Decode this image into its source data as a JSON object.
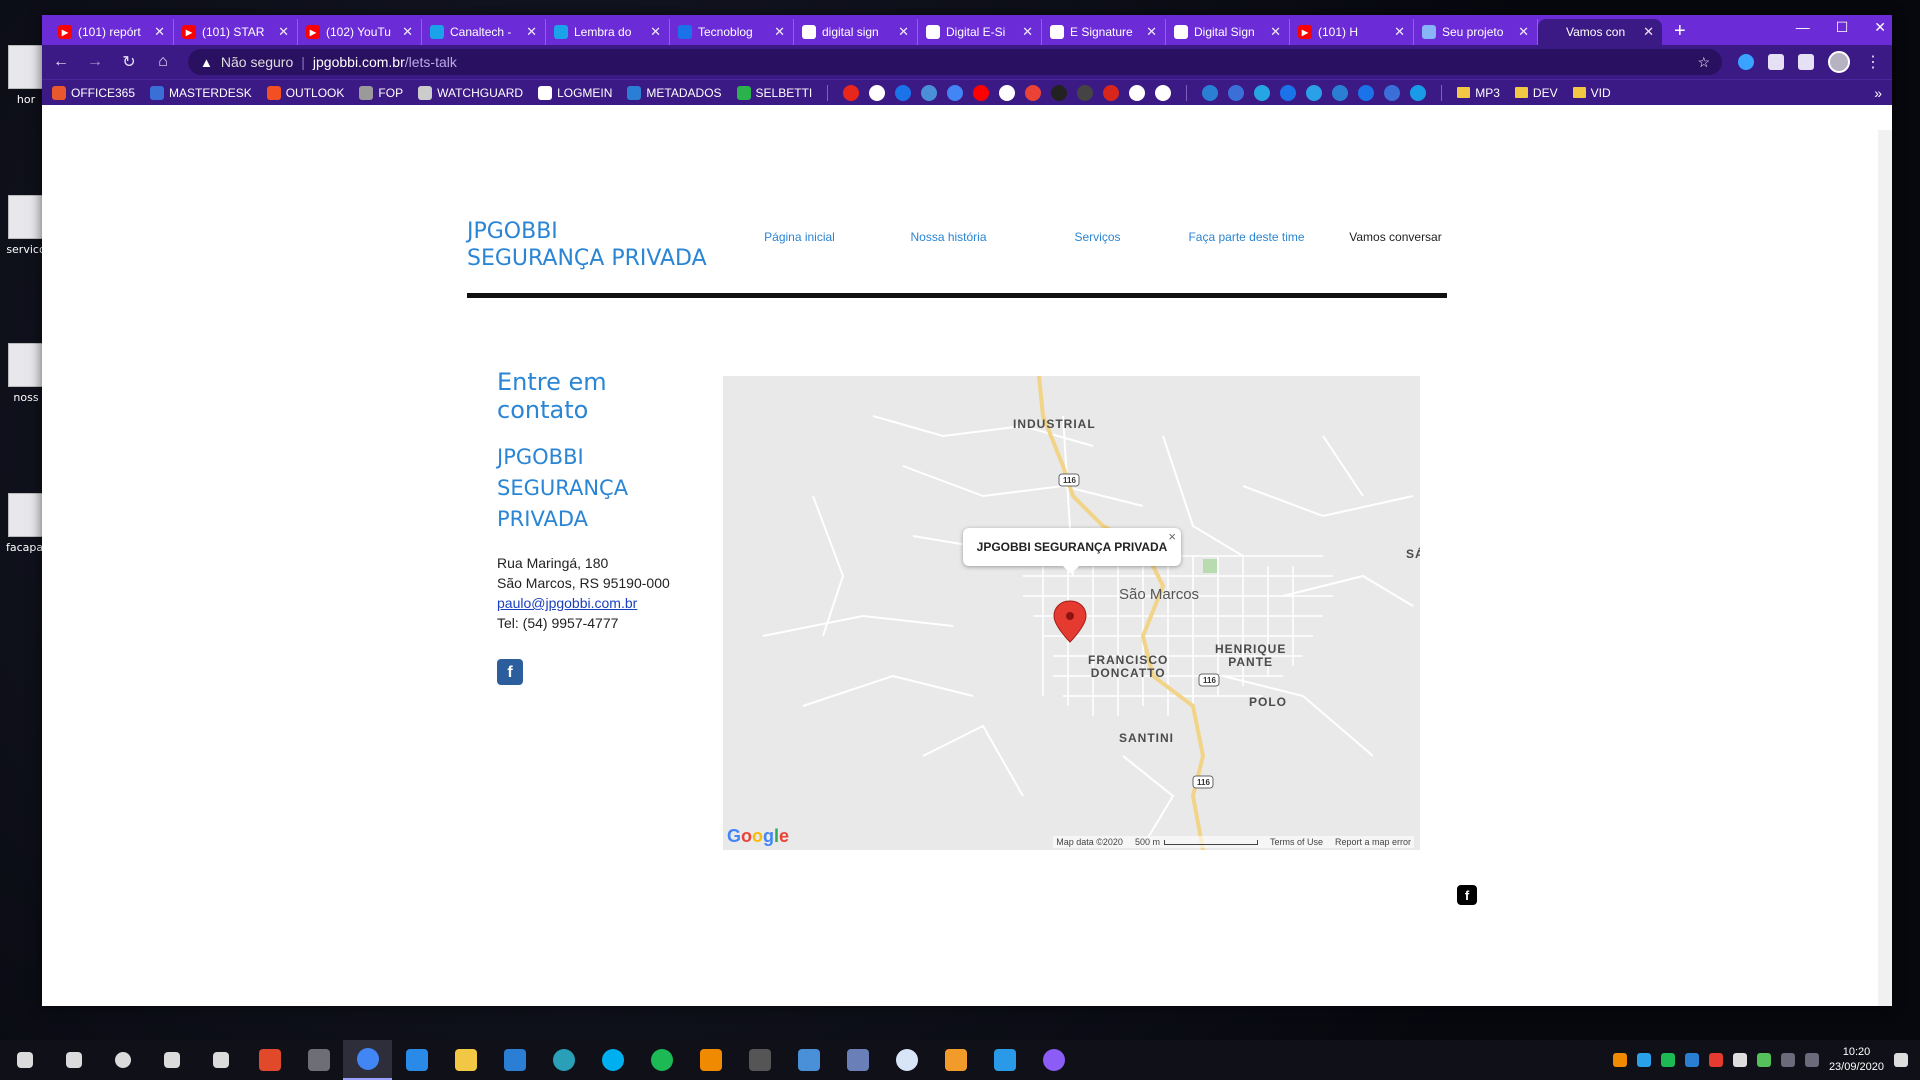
{
  "desktop": {
    "icons": [
      {
        "label": "hor"
      },
      {
        "label": "servico"
      },
      {
        "label": "noss"
      },
      {
        "label": "facapar"
      }
    ]
  },
  "browser": {
    "tabs": [
      {
        "title": "(101) repórt",
        "icon": "youtube",
        "color": "#ff0000"
      },
      {
        "title": "(101) STAR",
        "icon": "youtube",
        "color": "#ff0000"
      },
      {
        "title": "(102) YouTu",
        "icon": "youtube",
        "color": "#ff0000"
      },
      {
        "title": "Canaltech -",
        "icon": "canaltech",
        "color": "#1aa3e8"
      },
      {
        "title": "Lembra do",
        "icon": "canaltech",
        "color": "#1aa3e8"
      },
      {
        "title": "Tecnoblog",
        "icon": "tecnoblog",
        "color": "#1a73e8"
      },
      {
        "title": "digital sign",
        "icon": "google",
        "color": "#ffffff"
      },
      {
        "title": "Digital E-Si",
        "icon": "doc",
        "color": "#ffffff"
      },
      {
        "title": "E Signature",
        "icon": "github",
        "color": "#ffffff"
      },
      {
        "title": "Digital Sign",
        "icon": "github",
        "color": "#ffffff"
      },
      {
        "title": "(101) H",
        "icon": "youtube",
        "color": "#ff0000"
      },
      {
        "title": "Seu projeto",
        "icon": "loading",
        "color": "#8ab4f8"
      },
      {
        "title": "Vamos con",
        "icon": "none",
        "color": "#3c1a85"
      }
    ],
    "active_tab_index": 12,
    "new_tab_label": "+",
    "window_controls": {
      "minimize": "—",
      "maximize": "☐",
      "close": "✕"
    },
    "address": {
      "security_label": "Não seguro",
      "host": "jpgobbi.com.br",
      "path": "/lets-talk"
    },
    "bookmarks": [
      {
        "label": "OFFICE365",
        "color": "#e8572d"
      },
      {
        "label": "MASTERDESK",
        "color": "#3b6fd8"
      },
      {
        "label": "OUTLOOK",
        "color": "#f25022"
      },
      {
        "label": "FOP",
        "color": "#9a9a9a"
      },
      {
        "label": "WATCHGUARD",
        "color": "#cccccc"
      },
      {
        "label": "LOGMEIN",
        "color": "#ffffff"
      },
      {
        "label": "METADADOS",
        "color": "#2a7fd4"
      },
      {
        "label": "SELBETTI",
        "color": "#2bb24c"
      }
    ],
    "bookmark_icon_colors": [
      "#e8261c",
      "#ffffff",
      "#1a73e8",
      "#4a90d9",
      "#4285f4",
      "#ff0000",
      "#ffffff",
      "#ea4335",
      "#222222",
      "#444444",
      "#d9261c",
      "#ffffff",
      "#ffffff"
    ],
    "bookmark_icon_colors_2": [
      "#2a7fd4",
      "#3b6fd8",
      "#26a5e4",
      "#1a73e8",
      "#2aa0e8",
      "#2a7fd4",
      "#1a73e8",
      "#3b6fd8",
      "#1a9be8"
    ],
    "bookmark_folders": [
      "MP3",
      "DEV",
      "VID"
    ],
    "more_bookmarks": "»"
  },
  "site": {
    "logo_line1": "JPGOBBI",
    "logo_line2": "SEGURANÇA PRIVADA",
    "menu": [
      {
        "label": "Página inicial",
        "current": false
      },
      {
        "label": "Nossa história",
        "current": false
      },
      {
        "label": "Serviços",
        "current": false
      },
      {
        "label": "Faça parte deste time",
        "current": false
      },
      {
        "label": "Vamos conversar",
        "current": true
      }
    ],
    "contact": {
      "heading": "Entre em contato",
      "company_line1": "JPGOBBI",
      "company_line2": "SEGURANÇA",
      "company_line3": "PRIVADA",
      "street": "Rua Maringá, 180",
      "city_line": "São Marcos, RS 95190-000",
      "email": "paulo@jpgobbi.com.br",
      "phone": "Tel: (54) 9957-4777",
      "facebook_glyph": "f"
    },
    "map": {
      "popup": "JPGOBBI SEGURANÇA PRIVADA",
      "popup_close": "×",
      "city": "São Marcos",
      "labels": {
        "industrial": "INDUSTRIAL",
        "henrique_pante_1": "HENRIQUE",
        "henrique_pante_2": "PANTE",
        "francisco_doncatto_1": "FRANCISCO",
        "francisco_doncatto_2": "DONCATTO",
        "polo": "POLO",
        "santini": "SANTINI",
        "edge": "SÁ"
      },
      "road_badge": "116",
      "google_logo": "Google",
      "map_data": "Map data ©2020",
      "scale": "500 m",
      "terms": "Terms of Use",
      "report": "Report a map error"
    },
    "footer_facebook_glyph": "f"
  },
  "taskbar": {
    "apps": [
      {
        "name": "windows",
        "color": "#ffffff"
      },
      {
        "name": "search",
        "color": "#ffffff"
      },
      {
        "name": "cortana",
        "color": "#ffffff"
      },
      {
        "name": "task-view",
        "color": "#ffffff"
      },
      {
        "name": "settings",
        "color": "#ffffff"
      },
      {
        "name": "app-color",
        "color": "#e04a2a"
      },
      {
        "name": "calculator",
        "color": "#6e6e78"
      },
      {
        "name": "chrome",
        "color": "#4285f4"
      },
      {
        "name": "blue-app",
        "color": "#2a8ae8"
      },
      {
        "name": "explorer",
        "color": "#f2c744"
      },
      {
        "name": "todo",
        "color": "#2a7fd4"
      },
      {
        "name": "edge",
        "color": "#2aa0b8"
      },
      {
        "name": "skype",
        "color": "#00aff0"
      },
      {
        "name": "spotify",
        "color": "#1db954"
      },
      {
        "name": "vlc",
        "color": "#f08a00"
      },
      {
        "name": "grey-app",
        "color": "#555555"
      },
      {
        "name": "screen-app",
        "color": "#4a90d9"
      },
      {
        "name": "lock-app",
        "color": "#6a7fb8"
      },
      {
        "name": "chat-app",
        "color": "#d8e4f8"
      },
      {
        "name": "sublime",
        "color": "#f29a2a"
      },
      {
        "name": "vscode",
        "color": "#2a9ae8"
      },
      {
        "name": "purple-app",
        "color": "#8b5cf6"
      }
    ],
    "active_app_index": 7,
    "time": "10:20",
    "date": "23/09/2020"
  }
}
